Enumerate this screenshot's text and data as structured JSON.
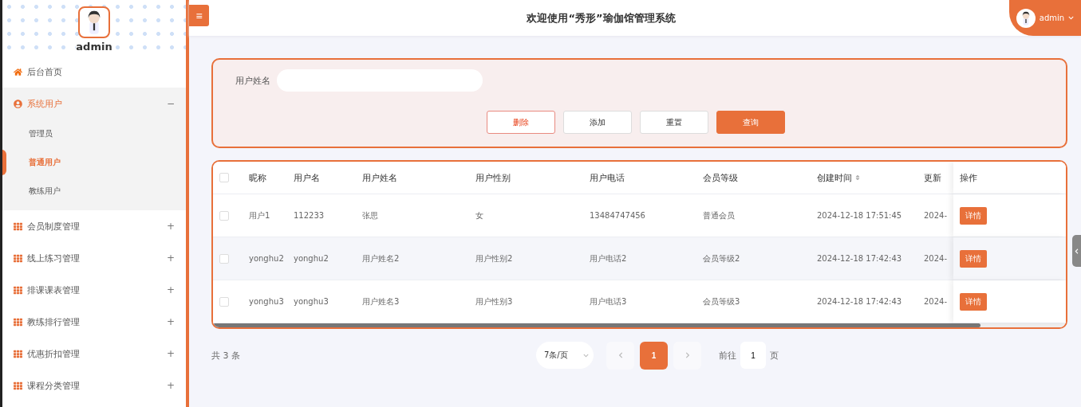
{
  "sidebar": {
    "username": "admin",
    "items": [
      {
        "label": "后台首页",
        "kind": "home",
        "expanded": false
      },
      {
        "label": "系统用户",
        "kind": "user",
        "expanded": true,
        "toggle": "−",
        "children": [
          {
            "label": "管理员",
            "selected": false
          },
          {
            "label": "普通用户",
            "selected": true
          },
          {
            "label": "教练用户",
            "selected": false
          }
        ]
      },
      {
        "label": "会员制度管理",
        "kind": "grid",
        "expanded": false,
        "toggle": "+"
      },
      {
        "label": "线上练习管理",
        "kind": "grid",
        "expanded": false,
        "toggle": "+"
      },
      {
        "label": "排课课表管理",
        "kind": "grid",
        "expanded": false,
        "toggle": "+"
      },
      {
        "label": "教练排行管理",
        "kind": "grid",
        "expanded": false,
        "toggle": "+"
      },
      {
        "label": "优惠折扣管理",
        "kind": "grid",
        "expanded": false,
        "toggle": "+"
      },
      {
        "label": "课程分类管理",
        "kind": "grid",
        "expanded": false,
        "toggle": "+"
      }
    ]
  },
  "header": {
    "menu_icon": "≡",
    "title": "欢迎使用“秀形”瑜伽馆管理系统",
    "user": "admin"
  },
  "search": {
    "label": "用户姓名",
    "buttons": [
      {
        "label": "删除",
        "kind": "danger"
      },
      {
        "label": "添加",
        "kind": "plain"
      },
      {
        "label": "重置",
        "kind": "plain"
      },
      {
        "label": "查询",
        "kind": "primary"
      }
    ]
  },
  "table": {
    "all_checked": false,
    "columns": [
      {
        "label": "昵称",
        "sortable": false
      },
      {
        "label": "用户名",
        "sortable": false
      },
      {
        "label": "用户姓名",
        "sortable": false
      },
      {
        "label": "用户性别",
        "sortable": false
      },
      {
        "label": "用户电话",
        "sortable": false
      },
      {
        "label": "会员等级",
        "sortable": false
      },
      {
        "label": "创建时间",
        "sortable": true
      },
      {
        "label": "更新",
        "sortable": false
      }
    ],
    "action_column": "操作",
    "rows": [
      {
        "checked": false,
        "cells": [
          "用户1",
          "112233",
          "张思",
          "女",
          "13484747456",
          "普通会员",
          "2024-12-18 17:51:45",
          "2024-"
        ],
        "action": "详情"
      },
      {
        "checked": false,
        "cells": [
          "yonghu2",
          "yonghu2",
          "用户姓名2",
          "用户性别2",
          "用户电话2",
          "会员等级2",
          "2024-12-18 17:42:43",
          "2024-"
        ],
        "action": "详情"
      },
      {
        "checked": false,
        "cells": [
          "yonghu3",
          "yonghu3",
          "用户姓名3",
          "用户性别3",
          "用户电话3",
          "会员等级3",
          "2024-12-18 17:42:43",
          "2024-"
        ],
        "action": "详情"
      }
    ]
  },
  "pagination": {
    "total": "共 3 条",
    "page_size": "7条/页",
    "pages": [
      {
        "label": "1",
        "selected": true
      }
    ],
    "goto_label": "前往",
    "goto_value": "1",
    "goto_suffix": "页"
  }
}
